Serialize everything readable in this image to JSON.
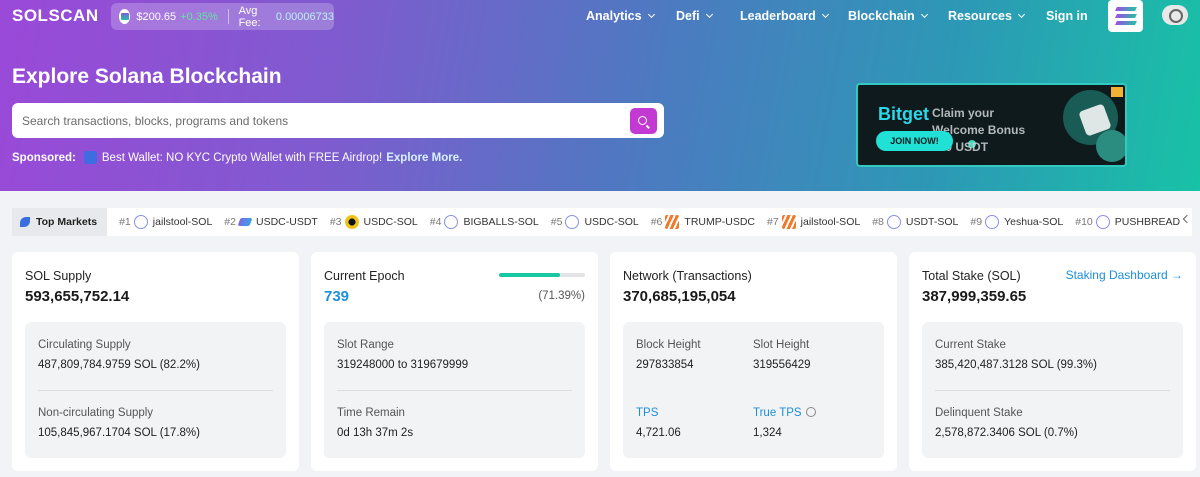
{
  "header": {
    "logo": "SOLSCAN",
    "sol_price": "$200.65",
    "sol_change": "+0.35%",
    "fee_label": "Avg Fee:",
    "fee_value": "0.00006733",
    "nav": [
      {
        "label": "Analytics"
      },
      {
        "label": "Defi"
      },
      {
        "label": "Leaderboard"
      },
      {
        "label": "Blockchain"
      },
      {
        "label": "Resources"
      },
      {
        "label": "Sign in"
      }
    ]
  },
  "hero": {
    "title": "Explore Solana Blockchain",
    "search_placeholder": "Search transactions, blocks, programs and tokens",
    "sponsored_label": "Sponsored:",
    "sponsored_text": "Best Wallet: NO KYC Crypto Wallet with FREE Airdrop!",
    "sponsored_link": "Explore More."
  },
  "ad": {
    "brand": "Bitget",
    "line1": "Claim your",
    "line2": "Welcome Bonus",
    "line3": "200 USDT",
    "cta": "JOIN NOW!"
  },
  "markets": {
    "label": "Top Markets",
    "items": [
      {
        "rank": "#1",
        "name": "jailstool-SOL",
        "icon": "raydium-icon"
      },
      {
        "rank": "#2",
        "name": "USDC-USDT",
        "icon": "usdc-icon"
      },
      {
        "rank": "#3",
        "name": "USDC-SOL",
        "icon": "coin-icon"
      },
      {
        "rank": "#4",
        "name": "BIGBALLS-SOL",
        "icon": "raydium-icon"
      },
      {
        "rank": "#5",
        "name": "USDC-SOL",
        "icon": "raydium-icon"
      },
      {
        "rank": "#6",
        "name": "TRUMP-USDC",
        "icon": "trump-icon"
      },
      {
        "rank": "#7",
        "name": "jailstool-SOL",
        "icon": "trump-icon"
      },
      {
        "rank": "#8",
        "name": "USDT-SOL",
        "icon": "raydium-icon"
      },
      {
        "rank": "#9",
        "name": "Yeshua-SOL",
        "icon": "raydium-icon"
      },
      {
        "rank": "#10",
        "name": "PUSHBREAD",
        "icon": "raydium-icon"
      }
    ]
  },
  "cards": {
    "supply": {
      "label": "SOL Supply",
      "value": "593,655,752.14",
      "circ_label": "Circulating Supply",
      "circ_value": "487,809,784.9759 SOL (82.2%)",
      "noncirc_label": "Non-circulating Supply",
      "noncirc_value": "105,845,967.1704 SOL (17.8%)"
    },
    "epoch": {
      "label": "Current Epoch",
      "value": "739",
      "percent": "(71.39%)",
      "progress": 0.7139,
      "slot_range_label": "Slot Range",
      "slot_range_value": "319248000 to 319679999",
      "time_label": "Time Remain",
      "time_value": "0d 13h 37m 2s"
    },
    "network": {
      "label": "Network (Transactions)",
      "value": "370,685,195,054",
      "block_height_label": "Block Height",
      "block_height_value": "297833854",
      "slot_height_label": "Slot Height",
      "slot_height_value": "319556429",
      "tps_label": "TPS",
      "tps_value": "4,721.06",
      "true_tps_label": "True TPS",
      "true_tps_value": "1,324"
    },
    "stake": {
      "label": "Total Stake (SOL)",
      "value": "387,999,359.65",
      "link": "Staking Dashboard →",
      "current_label": "Current Stake",
      "current_value": "385,420,487.3128 SOL (99.3%)",
      "delinquent_label": "Delinquent Stake",
      "delinquent_value": "2,578,872.3406 SOL (0.7%)"
    }
  },
  "colors": {
    "accent": "#1d8fd8",
    "search_button": "#c23ad1",
    "progress": "#18c8a2"
  }
}
